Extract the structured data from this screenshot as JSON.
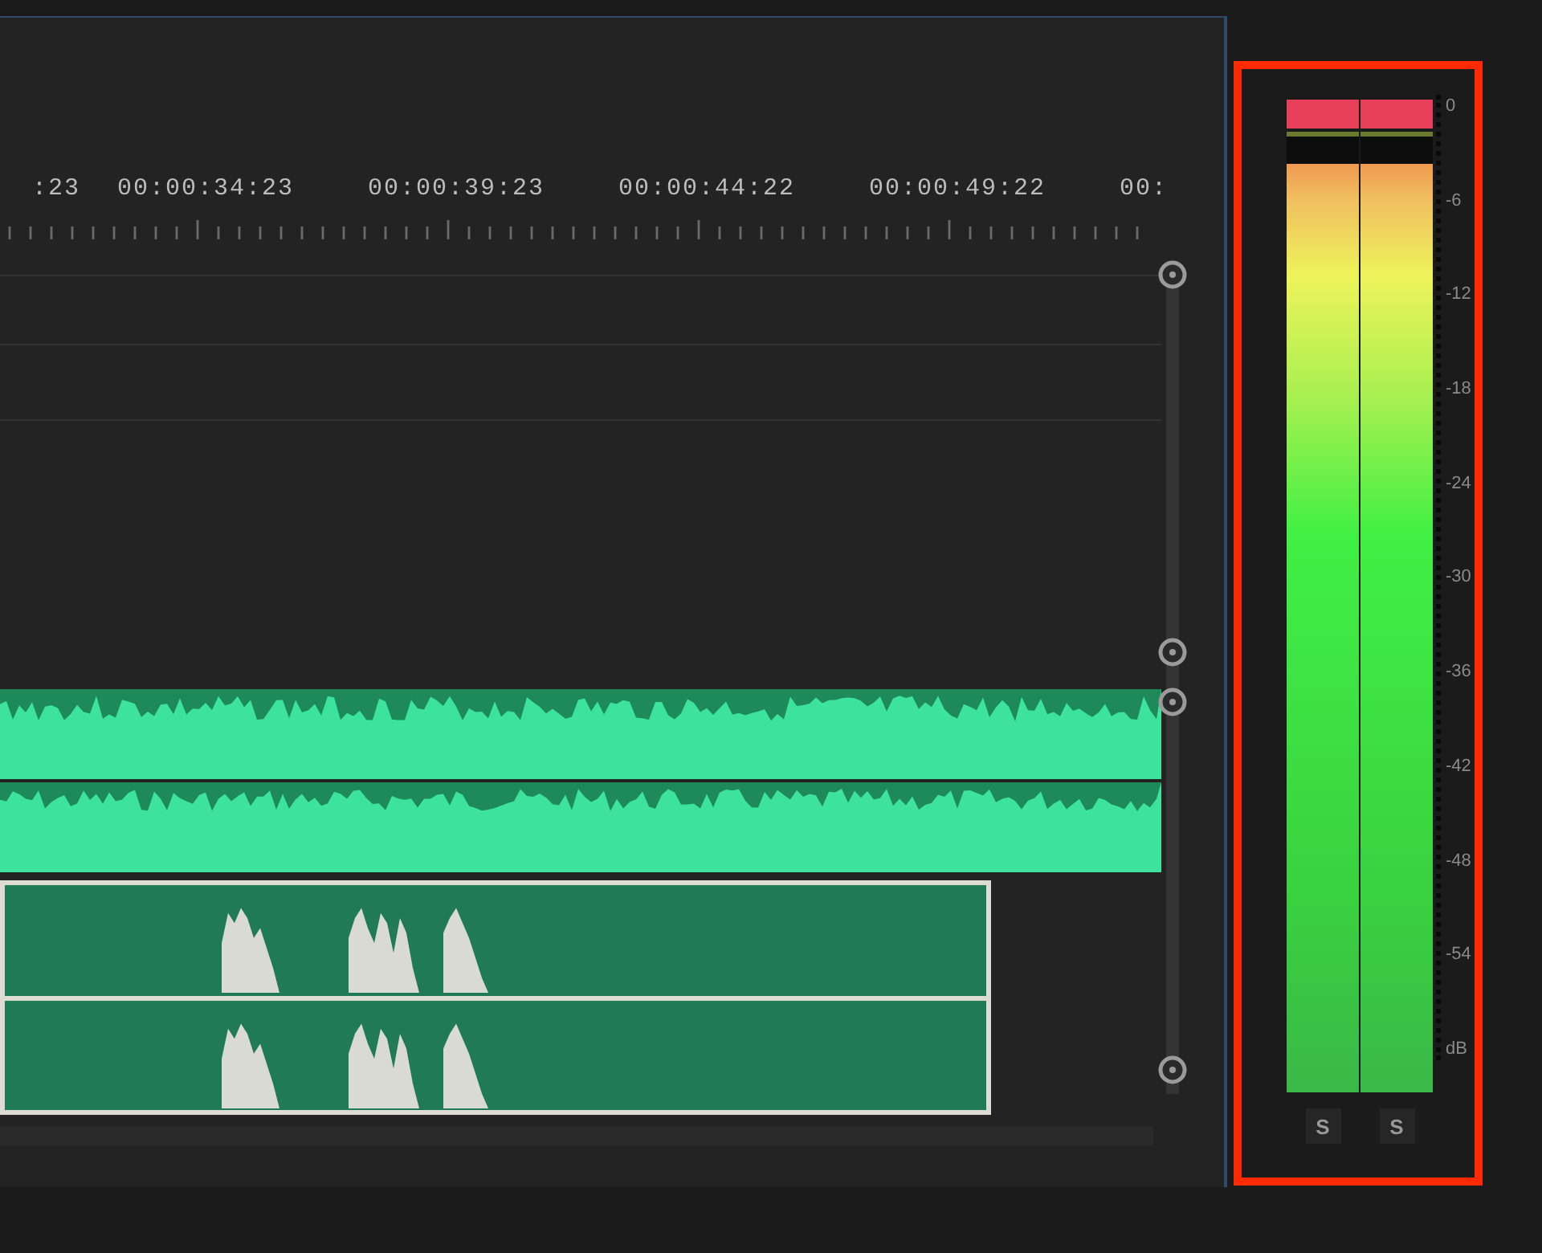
{
  "timeline": {
    "ruler_labels": [
      ":23",
      "00:00:34:23",
      "00:00:39:23",
      "00:00:44:22",
      "00:00:49:22",
      "00:"
    ]
  },
  "audio_meter": {
    "channels": [
      {
        "level": 1,
        "clipped": true,
        "solo": {
          "label": "S",
          "selected": false
        }
      },
      {
        "level": 1,
        "clipped": true,
        "solo": {
          "label": "S",
          "selected": false
        }
      }
    ],
    "scale": [
      "0",
      "-6",
      "-12",
      "-18",
      "-24",
      "-30",
      "-36",
      "-42",
      "-48",
      "-54",
      "dB"
    ]
  }
}
